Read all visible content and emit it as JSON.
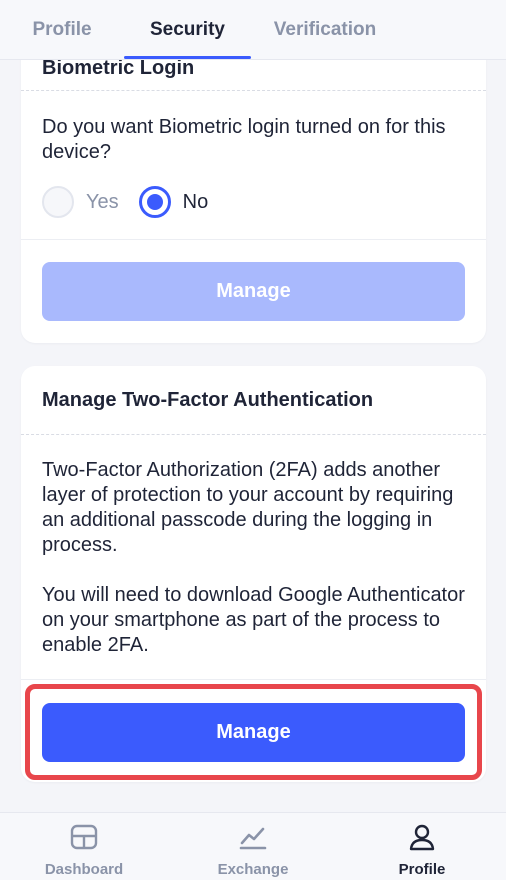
{
  "tabs": [
    {
      "label": "Profile",
      "active": false
    },
    {
      "label": "Security",
      "active": true
    },
    {
      "label": "Verification",
      "active": false
    }
  ],
  "biometric_card": {
    "title": "Biometric Login",
    "question": "Do you want Biometric login turned on for this device?",
    "options": [
      {
        "label": "Yes",
        "selected": false
      },
      {
        "label": "No",
        "selected": true
      }
    ],
    "button_label": "Manage",
    "button_enabled": false
  },
  "twofa_card": {
    "title": "Manage Two-Factor Authentication",
    "paragraph1": "Two-Factor Authorization (2FA) adds another layer of protection to your account by requiring an additional passcode during the logging in process.",
    "paragraph2": "You will need to download Google Authenticator on your smartphone as part of the process to enable 2FA.",
    "button_label": "Manage",
    "button_highlighted": true
  },
  "bottom_nav": [
    {
      "label": "Dashboard",
      "icon": "dashboard-icon",
      "active": false
    },
    {
      "label": "Exchange",
      "icon": "exchange-chart-icon",
      "active": false
    },
    {
      "label": "Profile",
      "icon": "profile-icon",
      "active": true
    }
  ],
  "colors": {
    "accent": "#3b5bfd",
    "accent_disabled": "#a9b9fd",
    "highlight": "#e8464b",
    "text": "#1f2437",
    "muted": "#8a93a8",
    "background": "#f4f5f9"
  }
}
